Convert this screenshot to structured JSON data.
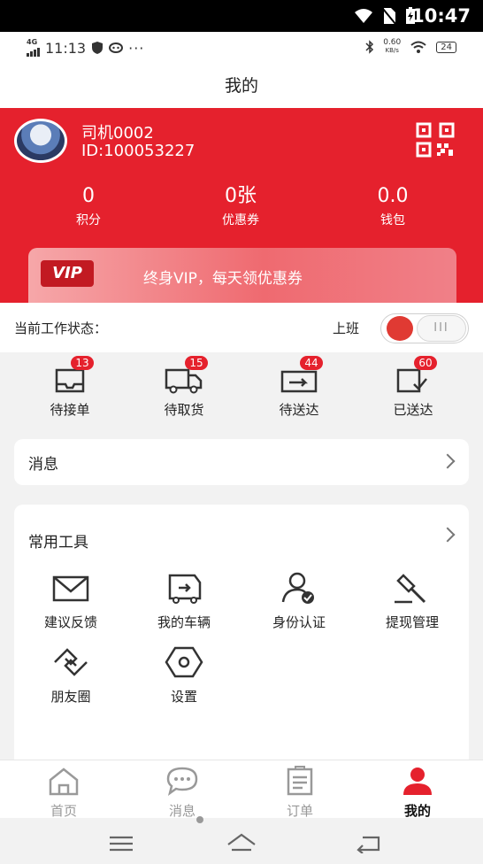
{
  "system_status": {
    "time": "10:47"
  },
  "device_status": {
    "time": "11:13",
    "network": "4G",
    "net_speed_value": "0.60",
    "net_speed_unit": "KB/s",
    "battery": "24"
  },
  "page": {
    "title": "我的"
  },
  "profile": {
    "name": "司机0002",
    "id_text": "ID:100053227"
  },
  "stats": [
    {
      "value": "0",
      "label": "积分"
    },
    {
      "value": "0张",
      "label": "优惠券"
    },
    {
      "value": "0.0",
      "label": "钱包"
    }
  ],
  "vip": {
    "badge": "VIP",
    "text": "终身VIP，每天领优惠券"
  },
  "work_status": {
    "label": "当前工作状态：",
    "state_label": "上班",
    "toggle_on": true,
    "thumb_text": "III"
  },
  "orders": [
    {
      "label": "待接单",
      "count": "13",
      "icon": "inbox-icon"
    },
    {
      "label": "待取货",
      "count": "15",
      "icon": "truck-icon"
    },
    {
      "label": "待送达",
      "count": "44",
      "icon": "delivery-box-icon"
    },
    {
      "label": "已送达",
      "count": "60",
      "icon": "delivered-check-icon"
    }
  ],
  "messages": {
    "title": "消息"
  },
  "tools": {
    "title": "常用工具",
    "items": [
      {
        "label": "建议反馈",
        "icon": "envelope-icon"
      },
      {
        "label": "我的车辆",
        "icon": "vehicle-icon"
      },
      {
        "label": "身份认证",
        "icon": "identity-verified-icon"
      },
      {
        "label": "提现管理",
        "icon": "gavel-icon"
      },
      {
        "label": "朋友圈",
        "icon": "handshake-icon"
      },
      {
        "label": "设置",
        "icon": "settings-hex-icon"
      }
    ]
  },
  "tabs": [
    {
      "label": "首页",
      "icon": "home-icon",
      "active": false
    },
    {
      "label": "消息",
      "icon": "chat-bubble-icon",
      "active": false
    },
    {
      "label": "订单",
      "icon": "clipboard-icon",
      "active": false
    },
    {
      "label": "我的",
      "icon": "user-icon",
      "active": true
    }
  ],
  "colors": {
    "brand_red": "#e5212d",
    "badge_red": "#e5212d"
  }
}
